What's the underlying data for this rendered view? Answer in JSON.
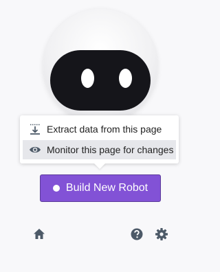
{
  "menu": {
    "items": [
      {
        "label": "Extract data from this page",
        "icon": "extract-download-icon"
      },
      {
        "label": "Monitor this page for changes",
        "icon": "eye-icon"
      }
    ]
  },
  "button": {
    "label": "Build New Robot",
    "icon": "record-dot-icon",
    "color": "#8252d6"
  },
  "footer": {
    "icons": [
      "home-icon",
      "help-icon",
      "gear-icon"
    ],
    "icon_color": "#4d5a68"
  }
}
